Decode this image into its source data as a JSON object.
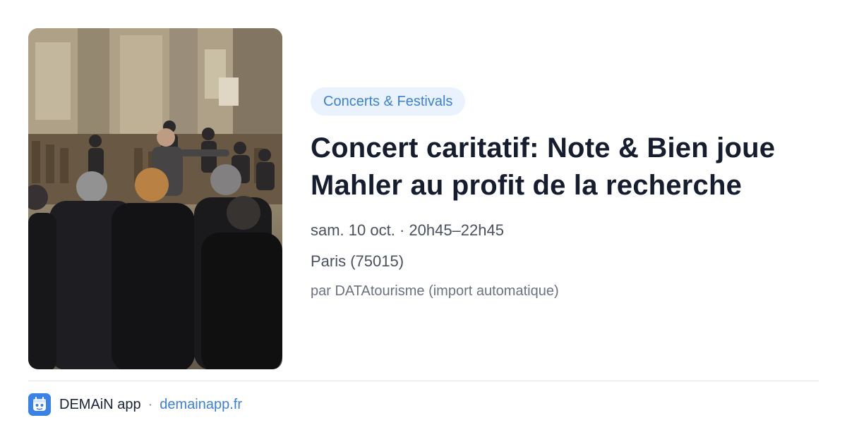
{
  "event": {
    "category": "Concerts & Festivals",
    "title": "Concert caritatif: Note & Bien joue Mahler au profit de la recherche",
    "datetime": "sam. 10 oct. · 20h45–22h45",
    "location": "Paris (75015)",
    "source": "par DATAtourisme (import automatique)"
  },
  "footer": {
    "app_name": "DEMAiN app",
    "separator": "·",
    "domain": "demainapp.fr",
    "icon": "demain-app-logo-icon"
  },
  "colors": {
    "accent": "#3d80d6",
    "pill_background": "#eaf3fd",
    "title": "#151d2e",
    "divider": "#dde3ea"
  }
}
